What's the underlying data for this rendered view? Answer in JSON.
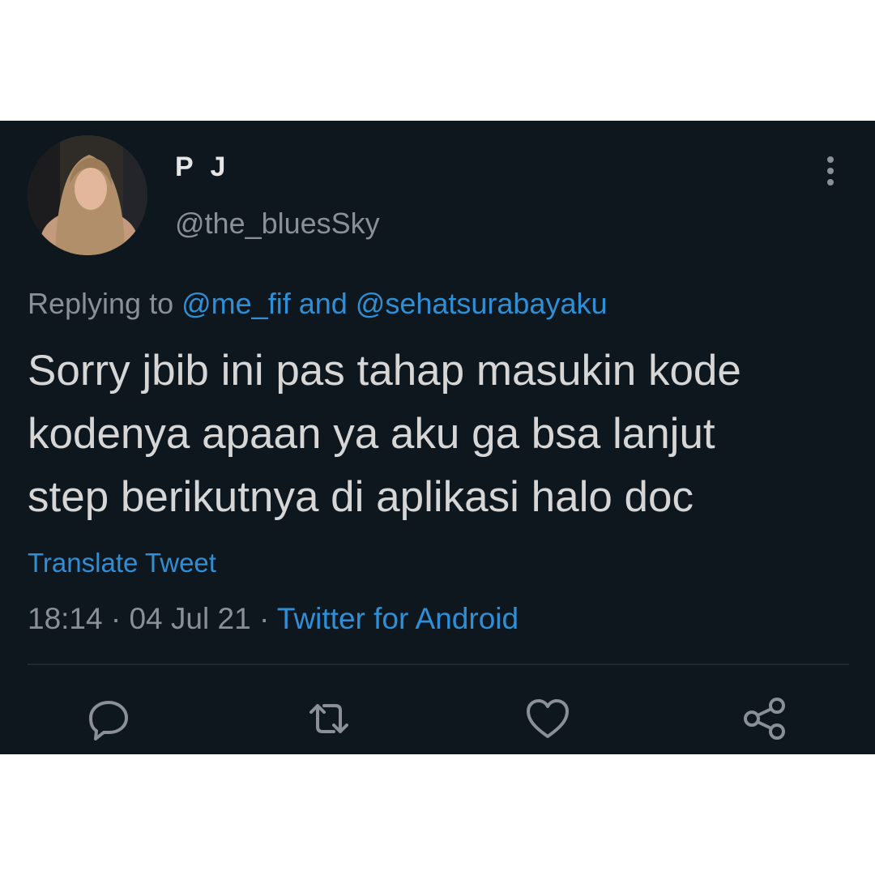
{
  "tweet": {
    "display_name": "P J",
    "handle": "@the_bluesSky",
    "replying_prefix": "Replying to",
    "replying_mentions": "@me_fif and @sehatsurabayaku",
    "text_lines": [
      "Sorry jbib ini pas tahap masukin kode",
      "kodenya apaan ya aku ga bsa lanjut",
      "step berikutnya di aplikasi halo doc"
    ],
    "translate_label": "Translate Tweet",
    "time": "18:14",
    "separator": "·",
    "date": "04 Jul 21",
    "source": "Twitter for Android"
  },
  "icons": {
    "avatar": "profile-photo",
    "more": "more-vertical-icon",
    "reply": "reply-icon",
    "retweet": "retweet-icon",
    "like": "heart-icon",
    "share": "share-icon"
  },
  "colors": {
    "background": "#0e171e",
    "text": "#d6d6d6",
    "muted": "#8a9096",
    "link": "#2f8fd6"
  }
}
